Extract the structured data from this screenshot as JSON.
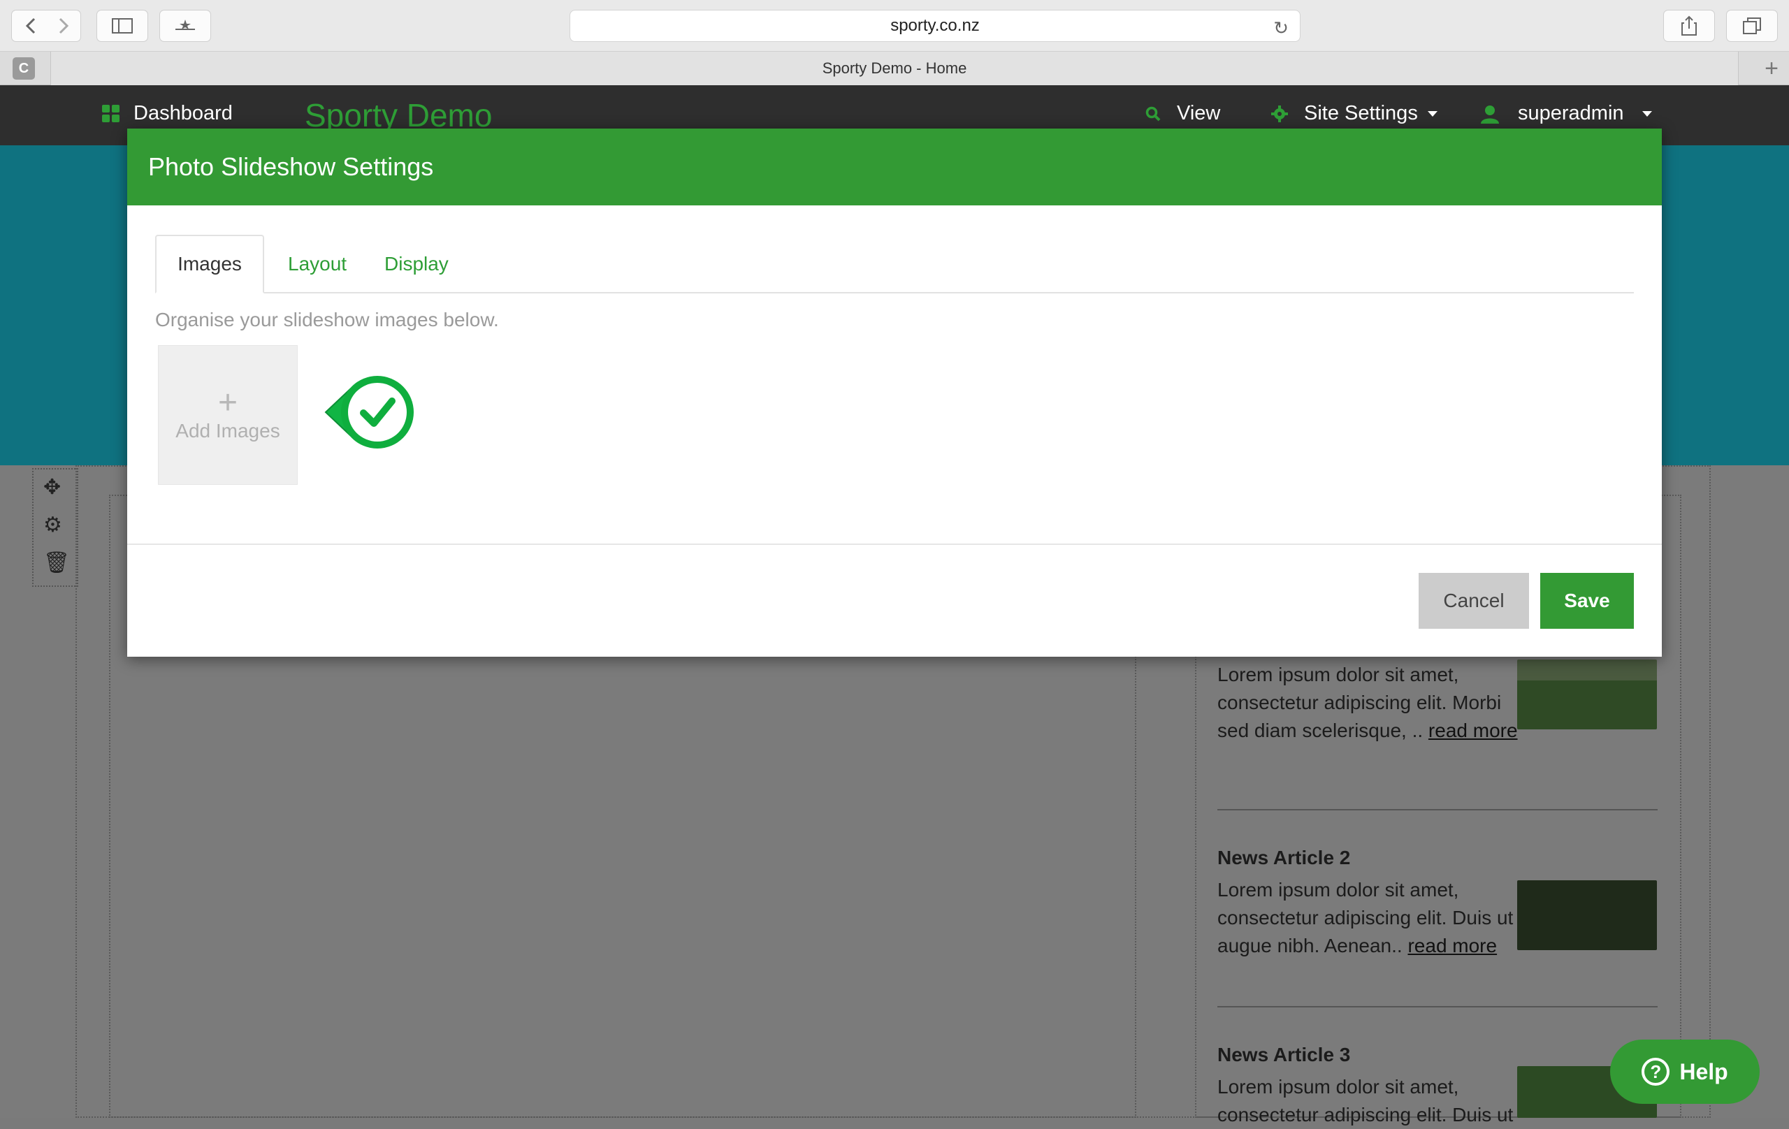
{
  "browser": {
    "url": "sporty.co.nz",
    "tab_title": "Sporty Demo - Home",
    "favicon_letter": "C"
  },
  "nav": {
    "dashboard": "Dashboard",
    "brand": "Sporty Demo",
    "view": "View",
    "site_settings": "Site Settings",
    "user": "superadmin"
  },
  "modal": {
    "title": "Photo Slideshow Settings",
    "tabs": [
      "Images",
      "Layout",
      "Display"
    ],
    "hint": "Organise your slideshow images below.",
    "add_plus": "+",
    "add_label": "Add Images",
    "cancel": "Cancel",
    "save": "Save"
  },
  "articles": [
    {
      "title": "",
      "text": "Lorem ipsum dolor sit amet, consectetur adipiscing elit. Morbi sed diam scelerisque, .. ",
      "link": "read more"
    },
    {
      "title": "News Article 2",
      "text": "Lorem ipsum dolor sit amet, consectetur adipiscing elit. Duis ut augue nibh. Aenean.. ",
      "link": "read more"
    },
    {
      "title": "News Article 3",
      "text": "Lorem ipsum dolor sit amet, consectetur adipiscing elit. Duis ut",
      "link": ""
    }
  ],
  "help": {
    "label": "Help",
    "q": "?"
  },
  "colors": {
    "brand_green": "#339a34",
    "banner_teal": "#0f7280",
    "nav_dark": "#2e2e2e"
  }
}
